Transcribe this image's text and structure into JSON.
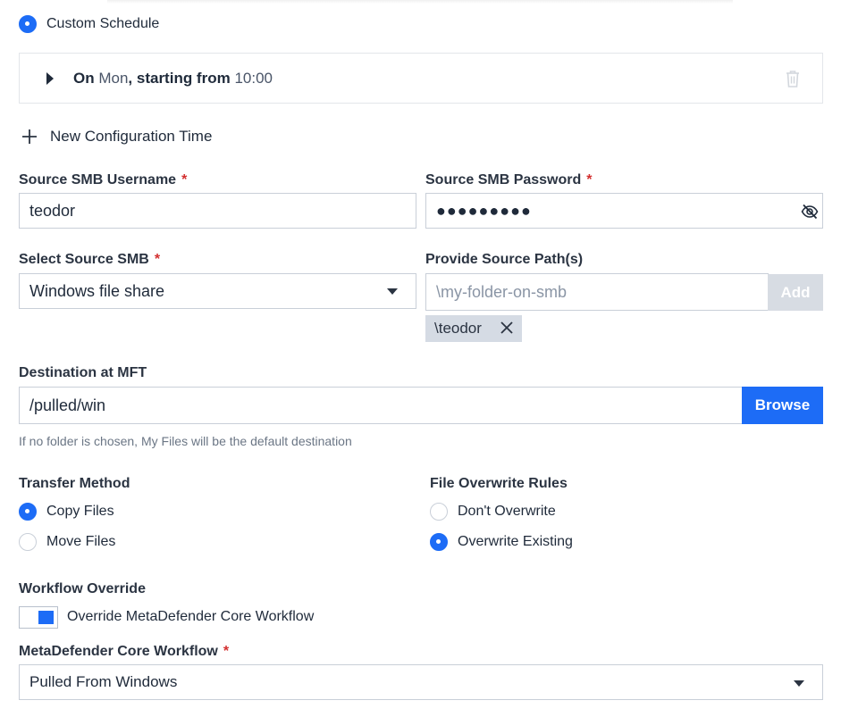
{
  "schedule": {
    "option_label": "Custom Schedule",
    "entry_prefix": "On ",
    "entry_day": "Mon",
    "entry_middle": ", starting from ",
    "entry_time": "10:00"
  },
  "new_configuration_label": "New Configuration Time",
  "username": {
    "label": "Source SMB Username",
    "required_mark": "*",
    "value": "teodor"
  },
  "password": {
    "label": "Source SMB Password",
    "required_mark": "*",
    "masked_value": "●●●●●●●●●"
  },
  "source_smb": {
    "label": "Select Source SMB",
    "required_mark": "*",
    "selected": "Windows file share"
  },
  "source_paths": {
    "label": "Provide Source Path(s)",
    "placeholder": "\\my-folder-on-smb",
    "add_label": "Add",
    "chips": [
      "\\teodor"
    ]
  },
  "destination": {
    "label": "Destination at MFT",
    "value": "/pulled/win",
    "browse_label": "Browse",
    "hint": "If no folder is chosen, My Files will be the default destination"
  },
  "transfer_method": {
    "label": "Transfer Method",
    "options": [
      {
        "label": "Copy Files",
        "selected": true
      },
      {
        "label": "Move Files",
        "selected": false
      }
    ]
  },
  "overwrite_rules": {
    "label": "File Overwrite Rules",
    "options": [
      {
        "label": "Don't Overwrite",
        "selected": false
      },
      {
        "label": "Overwrite Existing",
        "selected": true
      }
    ]
  },
  "workflow_override": {
    "label": "Workflow Override",
    "toggle_label": "Override MetaDefender Core Workflow",
    "enabled": true
  },
  "core_workflow": {
    "label": "MetaDefender Core Workflow",
    "required_mark": "*",
    "selected": "Pulled From Windows"
  },
  "colors": {
    "accent": "#1d6cf6",
    "required": "#d32f2f",
    "disabled_button": "#d7dce3",
    "chip": "#d5dbe4"
  }
}
